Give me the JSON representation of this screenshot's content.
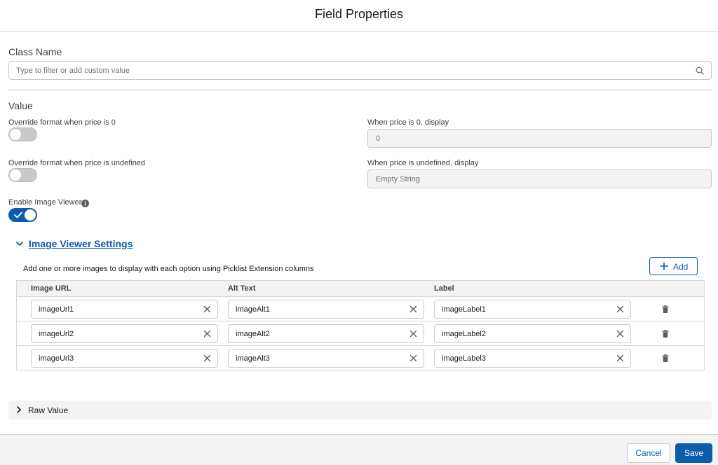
{
  "header": {
    "title": "Field Properties"
  },
  "class_name": {
    "label": "Class Name",
    "placeholder": "Type to filter or add custom value",
    "icon": "search-icon"
  },
  "value_section": {
    "label": "Value",
    "override_zero": {
      "label": "Override format when price is 0",
      "enabled": false
    },
    "zero_display": {
      "label": "When price is 0, display",
      "value": "0"
    },
    "override_undefined": {
      "label": "Override format when price is undefined",
      "enabled": false
    },
    "undefined_display": {
      "label": "When price is undefined, display",
      "value": "Empty String"
    },
    "image_viewer": {
      "label": "Enable Image Viewer",
      "enabled": true
    }
  },
  "image_viewer_settings": {
    "title": "Image Viewer Settings",
    "expanded": true,
    "description": "Add one or more images to display with each option using Picklist Extension columns",
    "add_label": "Add",
    "columns": [
      "Image URL",
      "Alt Text",
      "Label"
    ],
    "rows": [
      {
        "url": "imageUrl1",
        "alt": "imageAlt1",
        "label": "imageLabel1"
      },
      {
        "url": "imageUrl2",
        "alt": "imageAlt2",
        "label": "imageLabel2"
      },
      {
        "url": "imageUrl3",
        "alt": "imageAlt3",
        "label": "imageLabel3"
      }
    ]
  },
  "raw_value": {
    "title": "Raw Value",
    "expanded": false
  },
  "footer": {
    "cancel_label": "Cancel",
    "save_label": "Save"
  },
  "colors": {
    "brand": "#0b5cab",
    "border": "#c9c9c9",
    "panel": "#f3f3f3",
    "text": "#181818"
  }
}
